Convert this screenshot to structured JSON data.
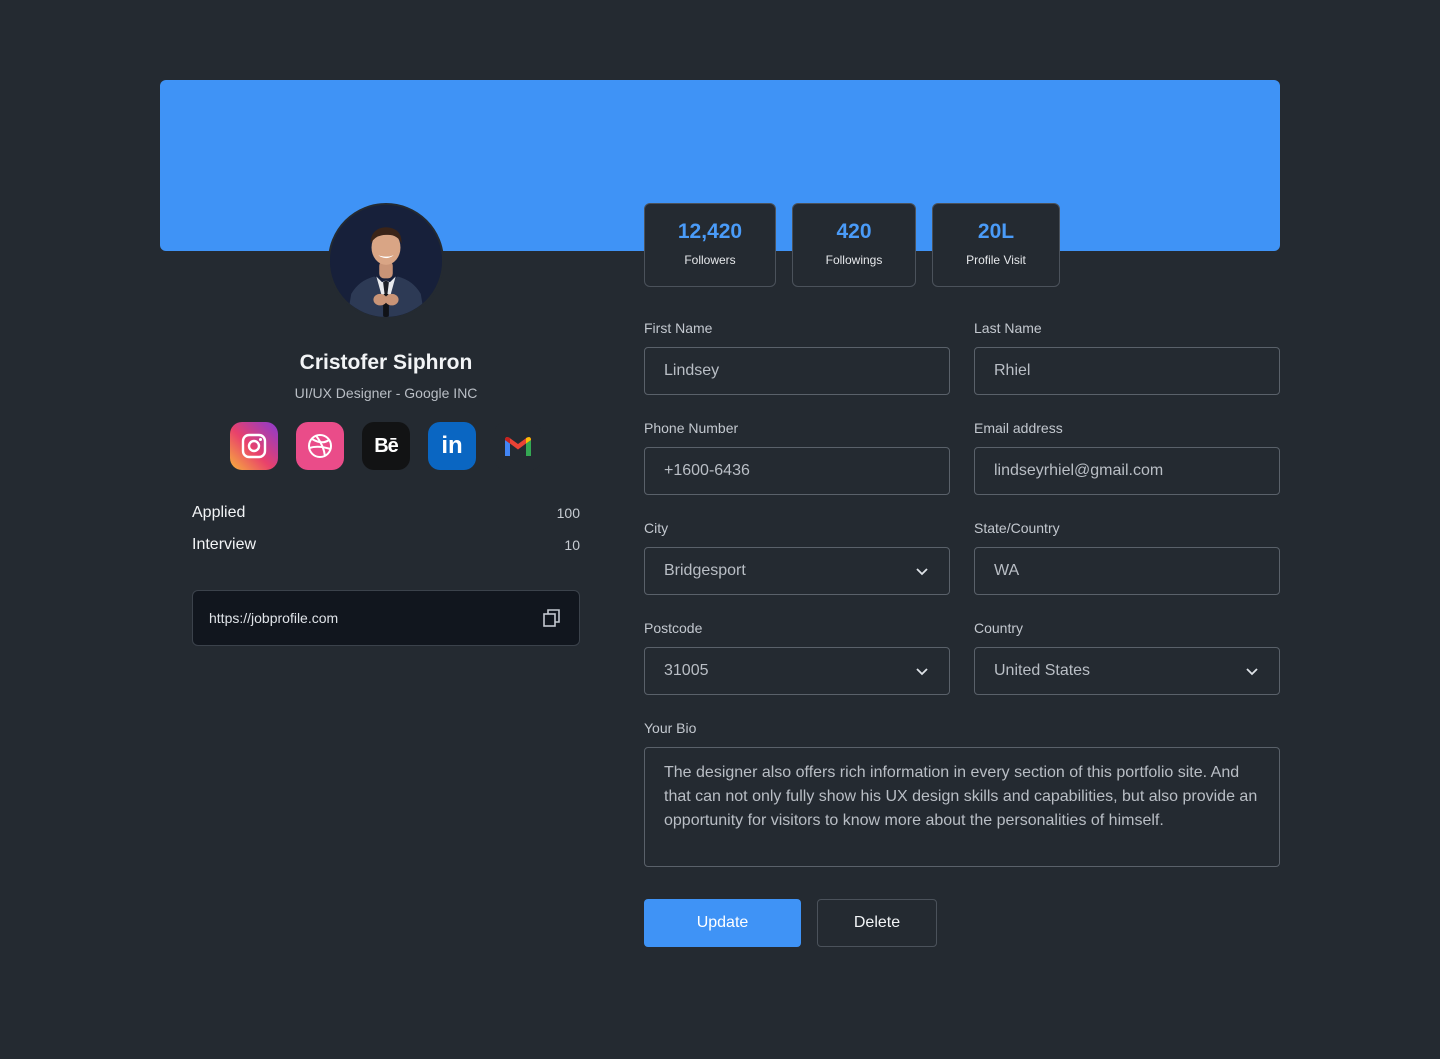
{
  "profile": {
    "name": "Cristofer Siphron",
    "role": "UI/UX Designer - Google INC",
    "socials": [
      {
        "name": "instagram",
        "icon": "instagram-icon"
      },
      {
        "name": "dribbble",
        "icon": "dribbble-icon"
      },
      {
        "name": "behance",
        "icon": "behance-icon",
        "label": "Bē"
      },
      {
        "name": "linkedin",
        "icon": "linkedin-icon",
        "label": "in"
      },
      {
        "name": "gmail",
        "icon": "gmail-icon"
      }
    ],
    "stats": {
      "applied_label": "Applied",
      "applied_value": "100",
      "interview_label": "Interview",
      "interview_value": "10"
    },
    "link": "https://jobprofile.com"
  },
  "cards": {
    "followers": {
      "value": "12,420",
      "label": "Followers"
    },
    "followings": {
      "value": "420",
      "label": "Followings"
    },
    "visits": {
      "value": "20L",
      "label": "Profile Visit"
    }
  },
  "form": {
    "first_name": {
      "label": "First Name",
      "value": "Lindsey"
    },
    "last_name": {
      "label": "Last Name",
      "value": "Rhiel"
    },
    "phone": {
      "label": "Phone Number",
      "value": "+1600-6436"
    },
    "email": {
      "label": "Email address",
      "value": "lindseyrhiel@gmail.com"
    },
    "city": {
      "label": "City",
      "value": "Bridgesport"
    },
    "state": {
      "label": "State/Country",
      "value": "WA"
    },
    "postcode": {
      "label": "Postcode",
      "value": "31005"
    },
    "country": {
      "label": "Country",
      "value": "United States"
    },
    "bio": {
      "label": "Your Bio",
      "value": "The designer also offers rich information in every section of this portfolio site. And that can not only fully show his UX design skills and capabilities, but also provide an opportunity for visitors to know more about the personalities of himself."
    }
  },
  "actions": {
    "update": "Update",
    "delete": "Delete"
  },
  "colors": {
    "accent": "#3f93f6",
    "background": "#242a31",
    "stat_number": "#4a9bf8"
  }
}
